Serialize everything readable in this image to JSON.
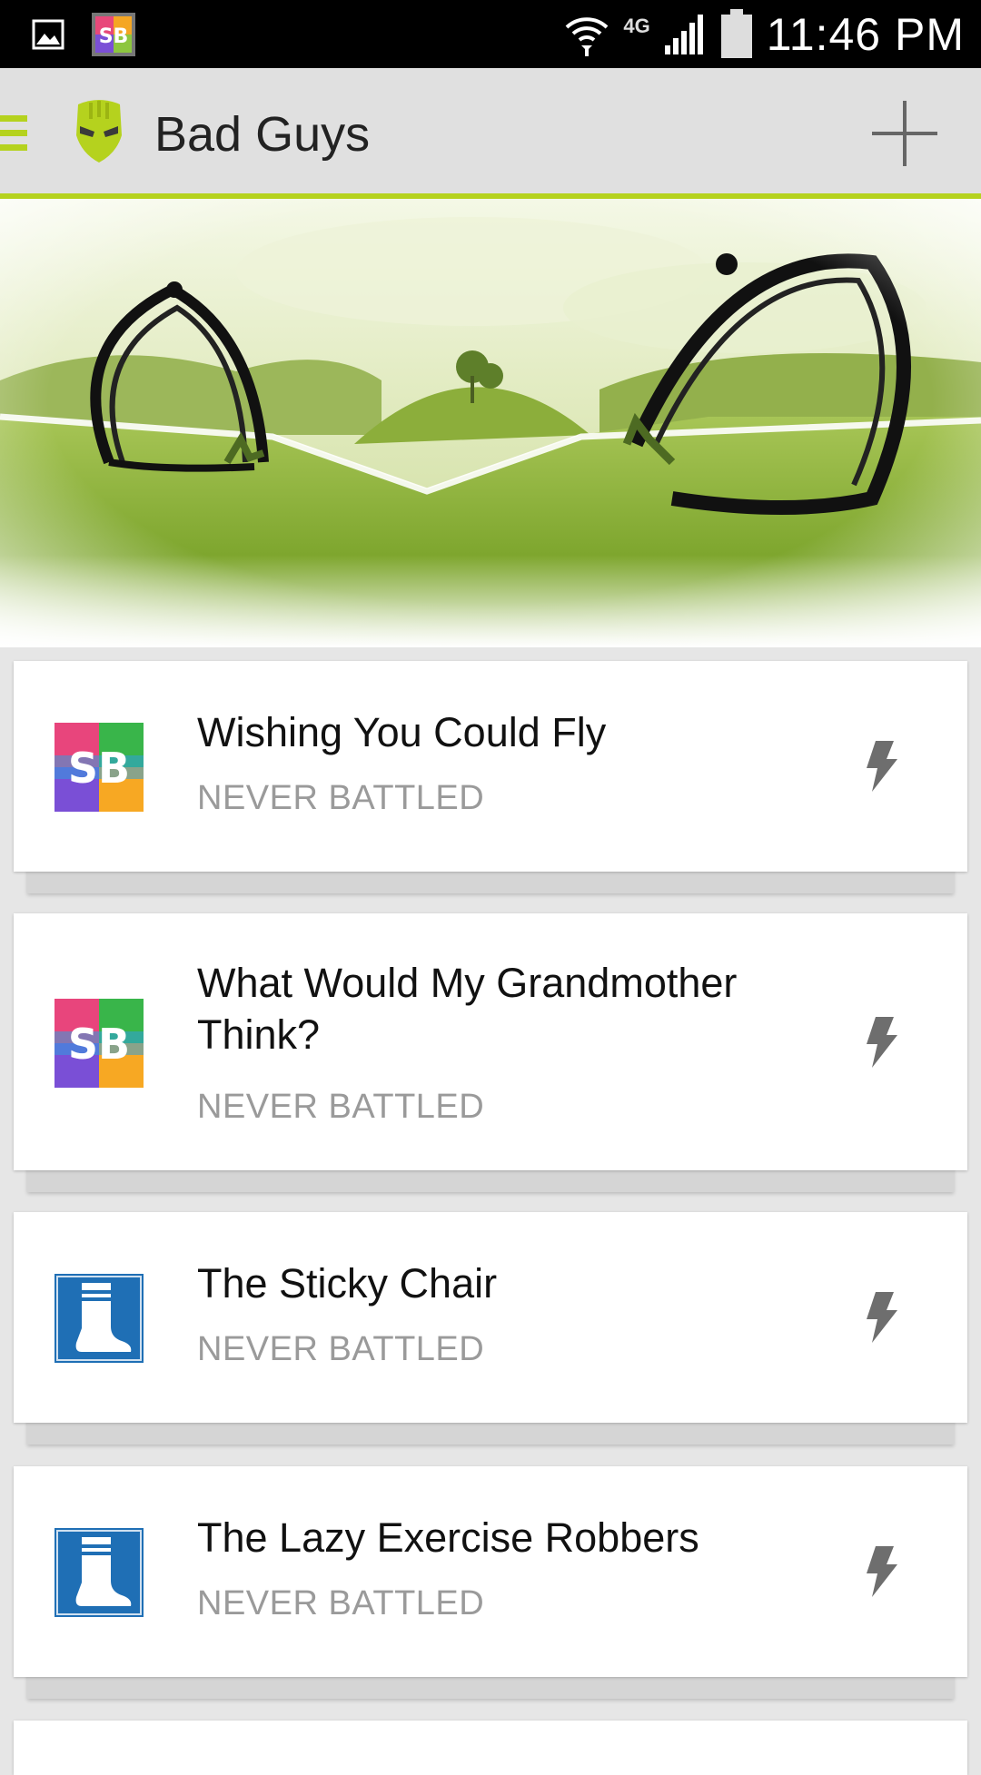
{
  "status_bar": {
    "time": "11:46 PM",
    "network": "4G",
    "icons": [
      "gallery-notification-icon",
      "app-notification-icon",
      "wifi-icon",
      "cellular-signal-icon",
      "battery-icon"
    ]
  },
  "app_bar": {
    "title": "Bad Guys",
    "accent_color": "#b5d21e",
    "icons": [
      "drawer-menu-icon",
      "helmet-logo-icon",
      "plus-icon"
    ]
  },
  "items": [
    {
      "title": "Wishing You Could Fly",
      "status": "NEVER BATTLED",
      "icon": "sb-logo-icon"
    },
    {
      "title": "What Would My Grandmother Think?",
      "status": "NEVER BATTLED",
      "icon": "sb-logo-icon"
    },
    {
      "title": "The Sticky Chair",
      "status": "NEVER BATTLED",
      "icon": "sock-icon"
    },
    {
      "title": "The Lazy Exercise Robbers",
      "status": "NEVER BATTLED",
      "icon": "sock-icon"
    }
  ],
  "colors": {
    "sock_blue": "#1f6fb5",
    "battle_icon": "#6e6e6e",
    "status_text": "#9a9a9a"
  }
}
